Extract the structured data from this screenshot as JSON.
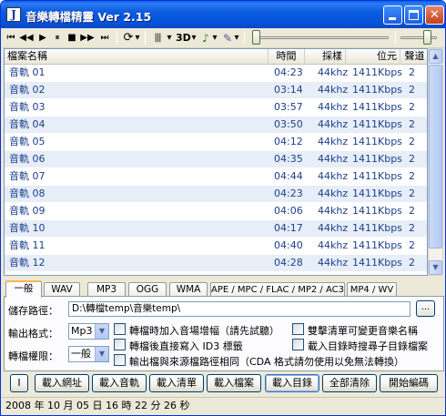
{
  "window": {
    "title": "音樂轉檔精靈 Ver 2.15",
    "icon_letter": "J"
  },
  "toolbar": {
    "buttons": [
      "⏮",
      "◀◀",
      "▶",
      "■",
      "⏸",
      "▶▶",
      "⏭",
      "⟳",
      "▾",
      "|||",
      "▾",
      "3D",
      "▾",
      "♪",
      "▾",
      "✎",
      "▾"
    ],
    "position_slider_fraction": 0.0,
    "volume_slider_fraction": 0.8
  },
  "list": {
    "columns": [
      "檔案名稱",
      "時間",
      "採樣",
      "位元",
      "聲道"
    ],
    "rows": [
      {
        "name": "音軌 01",
        "time": "04:23",
        "rate": "44khz",
        "bitrate": "1411Kbps",
        "ch": "2"
      },
      {
        "name": "音軌 02",
        "time": "03:14",
        "rate": "44khz",
        "bitrate": "1411Kbps",
        "ch": "2"
      },
      {
        "name": "音軌 03",
        "time": "03:57",
        "rate": "44khz",
        "bitrate": "1411Kbps",
        "ch": "2"
      },
      {
        "name": "音軌 04",
        "time": "03:50",
        "rate": "44khz",
        "bitrate": "1411Kbps",
        "ch": "2"
      },
      {
        "name": "音軌 05",
        "time": "04:12",
        "rate": "44khz",
        "bitrate": "1411Kbps",
        "ch": "2"
      },
      {
        "name": "音軌 06",
        "time": "04:35",
        "rate": "44khz",
        "bitrate": "1411Kbps",
        "ch": "2"
      },
      {
        "name": "音軌 07",
        "time": "04:44",
        "rate": "44khz",
        "bitrate": "1411Kbps",
        "ch": "2"
      },
      {
        "name": "音軌 08",
        "time": "04:23",
        "rate": "44khz",
        "bitrate": "1411Kbps",
        "ch": "2"
      },
      {
        "name": "音軌 09",
        "time": "04:06",
        "rate": "44khz",
        "bitrate": "1411Kbps",
        "ch": "2"
      },
      {
        "name": "音軌 10",
        "time": "04:17",
        "rate": "44khz",
        "bitrate": "1411Kbps",
        "ch": "2"
      },
      {
        "name": "音軌 11",
        "time": "04:40",
        "rate": "44khz",
        "bitrate": "1411Kbps",
        "ch": "2"
      },
      {
        "name": "音軌 12",
        "time": "04:28",
        "rate": "44khz",
        "bitrate": "1411Kbps",
        "ch": "2"
      }
    ]
  },
  "tabs": [
    "一般",
    "WAV",
    "MP3",
    "OGG",
    "WMA",
    "APE / MPC / FLAC / MP2 / AC3",
    "MP4 / WV"
  ],
  "general": {
    "output_path_label": "儲存路徑：",
    "output_path_value": "D:\\轉檔temp\\音樂temp\\",
    "browse_label": "...",
    "format_label": "輸出格式：",
    "format_value": "Mp3",
    "priority_label": "轉檔權限：",
    "priority_value": "一般",
    "options": [
      {
        "label": "轉檔時加入音場增幅（請先試聽）",
        "checked": false
      },
      {
        "label": "轉檔後直接寫入 ID3 標籤",
        "checked": false
      },
      {
        "label": "輸出檔與來源檔路徑相同（CDA 格式請勿使用以免無法轉換）",
        "checked": false
      },
      {
        "label": "雙擊清單可變更音樂名稱",
        "checked": false
      },
      {
        "label": "載入目錄時搜尋子目錄檔案",
        "checked": false
      }
    ]
  },
  "actions": [
    "I",
    "載入網址",
    "載入音軌",
    "載入清單",
    "載入檔案",
    "載入目錄",
    "全部清除",
    "開始編碼"
  ],
  "status": {
    "text": "2008 年 10 月 05 日 16 時 22 分 26 秒"
  }
}
